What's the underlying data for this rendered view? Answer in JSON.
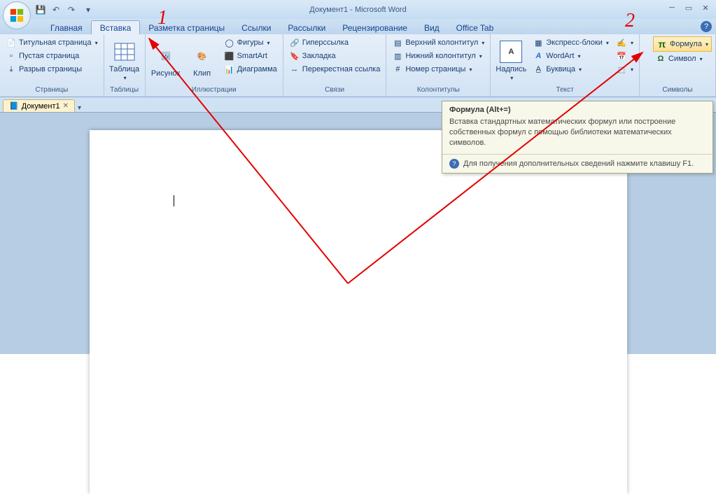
{
  "title": "Документ1 - Microsoft Word",
  "qat": {
    "save": "💾",
    "undo": "↶",
    "redo": "↷"
  },
  "tabs": {
    "items": [
      "Главная",
      "Вставка",
      "Разметка страницы",
      "Ссылки",
      "Рассылки",
      "Рецензирование",
      "Вид",
      "Office Tab"
    ],
    "active_index": 1
  },
  "ribbon": {
    "pages": {
      "title_page": "Титульная страница",
      "blank_page": "Пустая страница",
      "page_break": "Разрыв страницы",
      "label": "Страницы"
    },
    "tables": {
      "table": "Таблица",
      "label": "Таблицы"
    },
    "illustrations": {
      "picture": "Рисунок",
      "clip": "Клип",
      "shapes": "Фигуры",
      "smartart": "SmartArt",
      "chart": "Диаграмма",
      "label": "Иллюстрации"
    },
    "links": {
      "hyperlink": "Гиперссылка",
      "bookmark": "Закладка",
      "crossref": "Перекрестная ссылка",
      "label": "Связи"
    },
    "hf": {
      "header": "Верхний колонтитул",
      "footer": "Нижний колонтитул",
      "pagenum": "Номер страницы",
      "label": "Колонтитулы"
    },
    "text": {
      "textbox": "Надпись",
      "quickparts": "Экспресс-блоки",
      "wordart": "WordArt",
      "dropcap": "Буквица",
      "label": "Текст"
    },
    "symbols": {
      "formula": "Формула",
      "symbol": "Символ",
      "label": "Символы"
    }
  },
  "doctab": {
    "name": "Документ1"
  },
  "tooltip": {
    "title": "Формула (Alt+=)",
    "body": "Вставка стандартных математических формул или построение собственных формул с помощью библиотеки математических символов.",
    "footer": "Для получения дополнительных сведений нажмите клавишу F1."
  },
  "annot": {
    "one": "1",
    "two": "2"
  }
}
